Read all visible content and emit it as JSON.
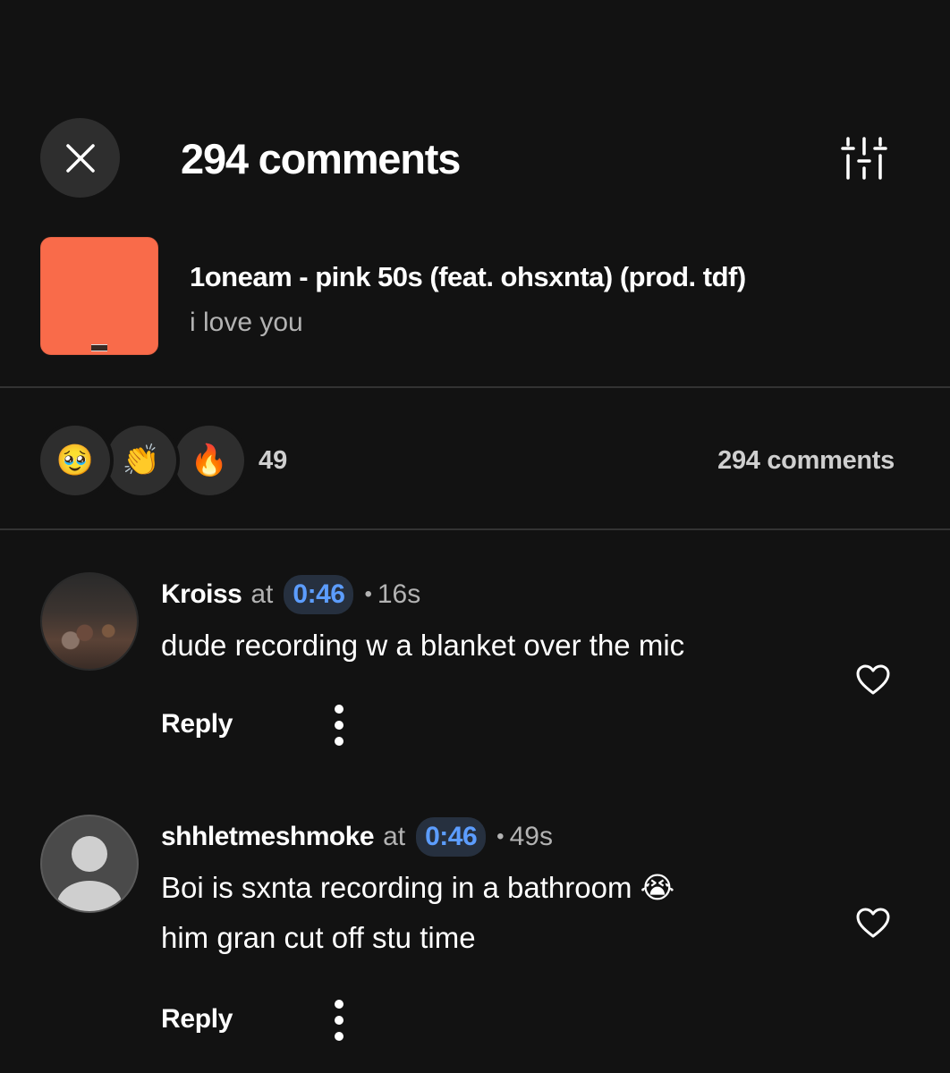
{
  "header": {
    "title": "294 comments"
  },
  "track": {
    "title": "1oneam - pink 50s (feat. ohsxnta) (prod. tdf)",
    "subtitle": "i love you",
    "cover_color": "#f96b4a"
  },
  "reactions": {
    "items": [
      {
        "icon": "pleading-face-icon",
        "glyph": "🥹"
      },
      {
        "icon": "clapping-hands-icon",
        "glyph": "👏"
      },
      {
        "icon": "fire-icon",
        "glyph": "🔥"
      }
    ],
    "count": "49",
    "comments_label": "294 comments"
  },
  "comments": [
    {
      "username": "Kroiss",
      "at": "at",
      "timestamp": "0:46",
      "dot": "•",
      "age": "16s",
      "lines": [
        "dude recording w a blanket over the mic"
      ],
      "reply_label": "Reply"
    },
    {
      "username": "shhletmeshmoke",
      "at": "at",
      "timestamp": "0:46",
      "dot": "•",
      "age": "49s",
      "lines": [
        "Boi is sxnta recording in a bathroom 😭",
        "him gran cut off stu time"
      ],
      "reply_label": "Reply"
    }
  ],
  "colors": {
    "background": "#121212",
    "surface": "#2e2e2e",
    "accent": "#5c9dff",
    "muted_text": "#b3b3b3"
  }
}
